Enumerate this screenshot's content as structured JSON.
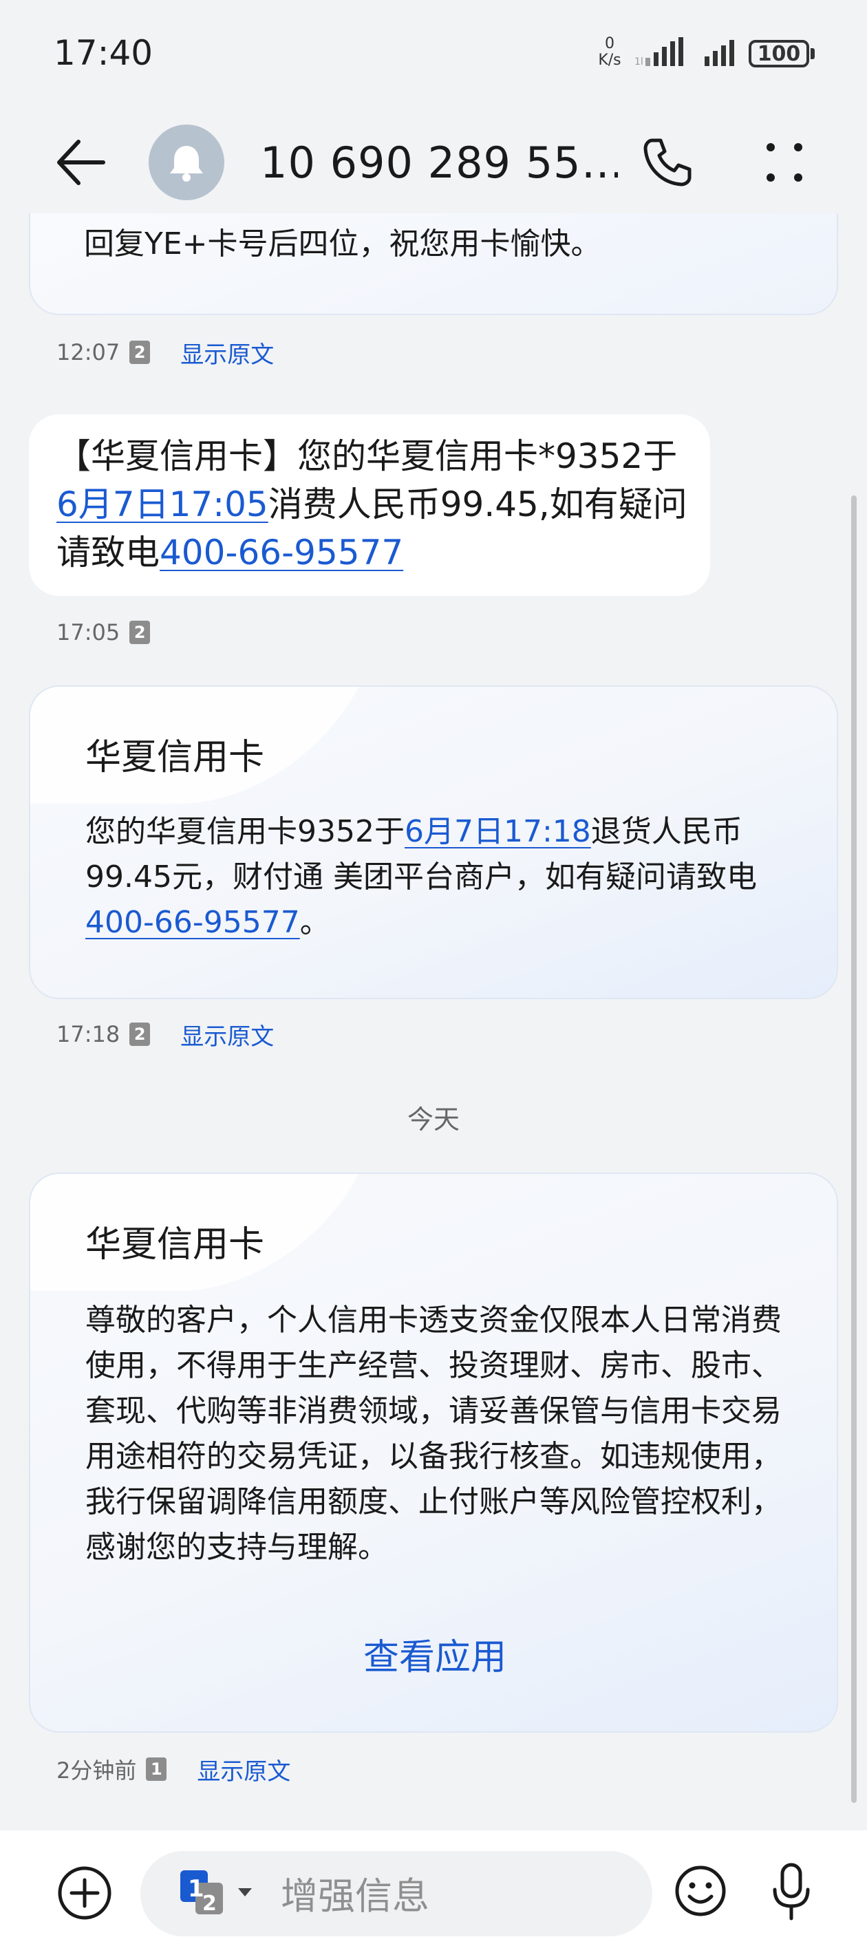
{
  "status_bar": {
    "time": "17:40",
    "net_speed_value": "0",
    "net_speed_unit": "K/s",
    "battery": "100"
  },
  "header": {
    "contact": "10 690 289 55…",
    "icons": [
      "back-arrow-icon",
      "bell-icon",
      "phone-icon",
      "more-icon"
    ]
  },
  "messages": [
    {
      "body": "回复YE+卡号后四位，祝您用卡愉快。",
      "time": "12:07",
      "sim": "2",
      "show_original": "显示原文"
    },
    {
      "body_prefix": "【华夏信用卡】您的华夏信用卡*9352于",
      "link_date": "6月7日17:05",
      "body_middle": "消费人民币99.45,如有疑问请致电",
      "link_phone": "400-66-95577",
      "time": "17:05",
      "sim": "2"
    },
    {
      "card_title": "华夏信用卡",
      "body_prefix": "您的华夏信用卡9352于",
      "link_date": "6月7日17:18",
      "body_middle": "退货人民币99.45元，财付通 美团平台商户，如有疑问请致电",
      "link_phone": "400-66-95577",
      "body_suffix": "。",
      "time": "17:18",
      "sim": "2",
      "show_original": "显示原文"
    },
    {
      "card_title": "华夏信用卡",
      "body": "尊敬的客户，个人信用卡透支资金仅限本人日常消费使用，不得用于生产经营、投资理财、房市、股市、套现、代购等非消费领域，请妥善保管与信用卡交易用途相符的交易凭证，以备我行核查。如违规使用，我行保留调降信用额度、止付账户等风险管控权利，感谢您的支持与理解。",
      "action": "查看应用",
      "time": "2分钟前",
      "sim": "1",
      "show_original": "显示原文"
    }
  ],
  "day_separator": "今天",
  "composer": {
    "placeholder": "增强信息",
    "sim_primary": "1",
    "sim_secondary": "2",
    "icons": [
      "add-icon",
      "sim-select-icon",
      "emoji-icon",
      "microphone-icon"
    ]
  },
  "colors": {
    "background": "#f1f3f5",
    "bubble": "#ffffff",
    "link": "#1a5ad1",
    "text": "#1a1a1a",
    "meta": "#666666"
  }
}
